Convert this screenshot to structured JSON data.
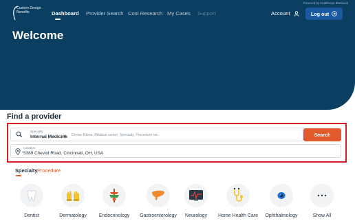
{
  "nav": {
    "logo_text": "Custom Design Benefits",
    "links": [
      {
        "label": "Dashboard",
        "active": true
      },
      {
        "label": "Provider Search",
        "active": false
      },
      {
        "label": "Cost Research",
        "active": false
      },
      {
        "label": "My Cases",
        "active": false
      },
      {
        "label": "Support",
        "active": false
      }
    ],
    "powered_by": "Powered by Healthcare Bluebook",
    "account_label": "Account",
    "logout_label": "Log out"
  },
  "hero": {
    "title": "Welcome"
  },
  "find": {
    "title": "Find a provider",
    "specialty_label": "Specialty",
    "specialty_value": "Internal Medicine",
    "specialty_placeholder": "Doctor Name, Medical center, Specialty, Procedure etc",
    "search_label": "Search",
    "location_label": "Location",
    "location_value": "5389 Cheviot Road, Cincinnati, OH, USA"
  },
  "tabs": {
    "specialty": "Specialty",
    "procedure": "Procedure"
  },
  "specialties": [
    {
      "label": "Dentist",
      "icon": "tooth-icon"
    },
    {
      "label": "Dermatology",
      "icon": "gloves-icon"
    },
    {
      "label": "Endocrinology",
      "icon": "endocrine-icon"
    },
    {
      "label": "Gastroenterology",
      "icon": "liver-icon"
    },
    {
      "label": "Neurology",
      "icon": "ecg-monitor-icon"
    },
    {
      "label": "Home Health Care",
      "icon": "stethoscope-icon"
    },
    {
      "label": "Ophthalmology",
      "icon": "eye-icon"
    },
    {
      "label": "Show All",
      "icon": "more-icon"
    }
  ],
  "colors": {
    "hero": "#0b3f61",
    "accent": "#e05a2b",
    "highlight_border": "#d21f26",
    "logout": "#1a5aa0"
  }
}
